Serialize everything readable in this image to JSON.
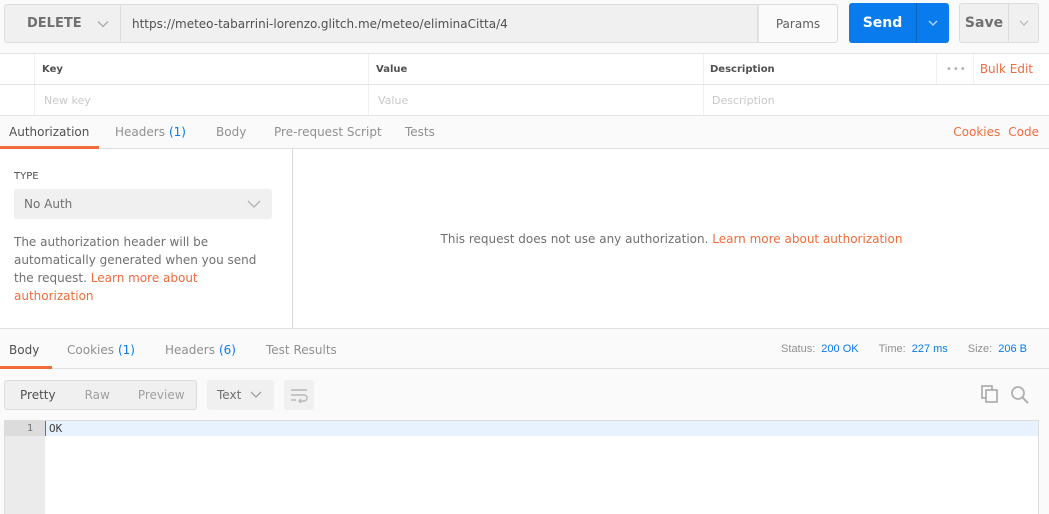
{
  "request": {
    "method": "DELETE",
    "url": "https://meteo-tabarrini-lorenzo.glitch.me/meteo/eliminaCitta/4",
    "params_label": "Params",
    "send_label": "Send",
    "save_label": "Save"
  },
  "params_table": {
    "headers": [
      "Key",
      "Value",
      "Description"
    ],
    "placeholders": [
      "New key",
      "Value",
      "Description"
    ],
    "more_label": "•••",
    "bulk_edit_label": "Bulk Edit"
  },
  "request_tabs": [
    {
      "label": "Authorization",
      "count": null
    },
    {
      "label": "Headers",
      "count": "(1)"
    },
    {
      "label": "Body",
      "count": null
    },
    {
      "label": "Pre-request Script",
      "count": null
    },
    {
      "label": "Tests",
      "count": null
    }
  ],
  "request_links": {
    "cookies": "Cookies",
    "code": "Code"
  },
  "auth": {
    "type_label": "TYPE",
    "type_value": "No Auth",
    "description": "The authorization header will be automatically generated when you send the request.",
    "learn_more": "Learn more about authorization",
    "no_auth_message": "This request does not use any authorization.",
    "no_auth_link": "Learn more about authorization"
  },
  "response_tabs": [
    {
      "label": "Body",
      "count": null
    },
    {
      "label": "Cookies",
      "count": "(1)"
    },
    {
      "label": "Headers",
      "count": "(6)"
    },
    {
      "label": "Test Results",
      "count": null
    }
  ],
  "response_meta": {
    "status_label": "Status:",
    "status_value": "200 OK",
    "time_label": "Time:",
    "time_value": "227 ms",
    "size_label": "Size:",
    "size_value": "206 B"
  },
  "response_toolbar": {
    "view_modes": [
      "Pretty",
      "Raw",
      "Preview"
    ],
    "format": "Text"
  },
  "response_body": {
    "lines": [
      {
        "number": "1",
        "text": "OK"
      }
    ]
  },
  "colors": {
    "accent": "#f26b3a",
    "primary": "#097bed"
  }
}
